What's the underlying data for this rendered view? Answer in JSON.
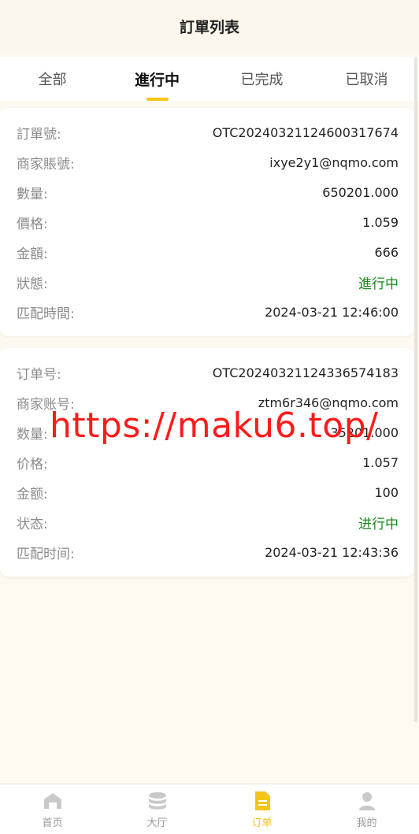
{
  "header": {
    "title": "訂單列表"
  },
  "tabs": [
    {
      "label": "全部"
    },
    {
      "label": "進行中"
    },
    {
      "label": "已完成"
    },
    {
      "label": "已取消"
    }
  ],
  "orders": [
    {
      "rows": [
        {
          "label": "訂單號:",
          "value": "OTC20240321124600317674"
        },
        {
          "label": "商家賬號:",
          "value": "ixye2y1@nqmo.com"
        },
        {
          "label": "數量:",
          "value": "650201.000"
        },
        {
          "label": "價格:",
          "value": "1.059"
        },
        {
          "label": "金額:",
          "value": "666"
        },
        {
          "label": "狀態:",
          "value": "進行中"
        },
        {
          "label": "匹配時間:",
          "value": "2024-03-21 12:46:00"
        }
      ]
    },
    {
      "rows": [
        {
          "label": "订单号:",
          "value": "OTC20240321124336574183"
        },
        {
          "label": "商家账号:",
          "value": "ztm6r346@nqmo.com"
        },
        {
          "label": "数量:",
          "value": "35201.000"
        },
        {
          "label": "价格:",
          "value": "1.057"
        },
        {
          "label": "金额:",
          "value": "100"
        },
        {
          "label": "状态:",
          "value": "进行中"
        },
        {
          "label": "匹配时间:",
          "value": "2024-03-21 12:43:36"
        }
      ]
    }
  ],
  "watermark": "https://maku6.top/",
  "tabbar": [
    {
      "label": "首页",
      "icon": "home-icon"
    },
    {
      "label": "大厅",
      "icon": "coins-icon"
    },
    {
      "label": "订单",
      "icon": "document-icon"
    },
    {
      "label": "我的",
      "icon": "user-icon"
    }
  ],
  "colors": {
    "accent": "#f5c518",
    "status": "#1a8a1a",
    "watermark": "#ff1a1a"
  }
}
